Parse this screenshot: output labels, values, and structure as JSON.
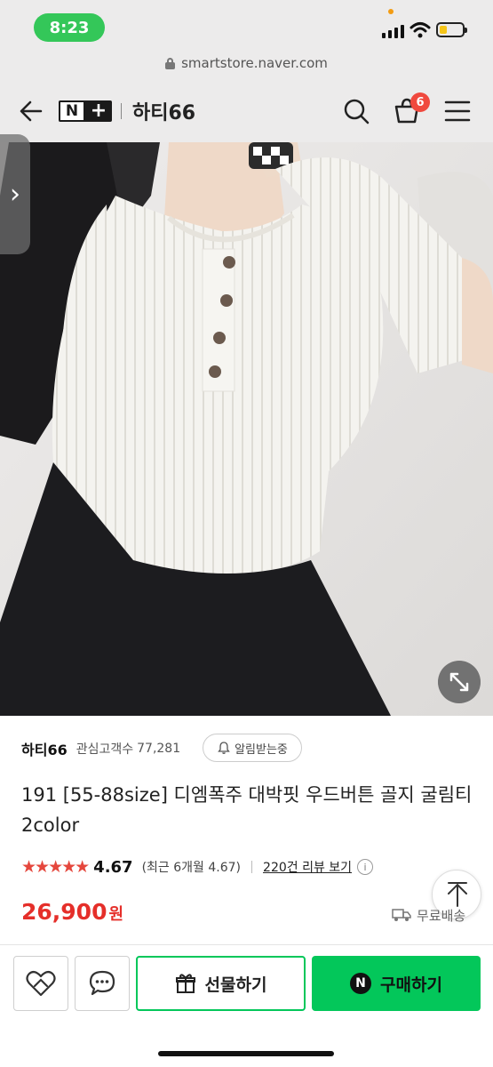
{
  "status_bar": {
    "time": "8:23",
    "battery_level": 0.35
  },
  "browser": {
    "url": "smartstore.naver.com"
  },
  "nav": {
    "logo_n": "N",
    "logo_plus": "+",
    "store_name": "하티66",
    "cart_count": "6"
  },
  "product": {
    "seller": "하티66",
    "follower_label": "관심고객수",
    "follower_count": "77,281",
    "notify_label": "알림받는중",
    "title": "191 [55-88size] 디엠폭주 대박핏 우드버튼 골지 굴림티 2color",
    "stars": "★★★★★",
    "rating": "4.67",
    "recent_rating": "(최근 6개월 4.67)",
    "review_link": "220건 리뷰 보기",
    "info_icon": "i",
    "price": "26,900",
    "currency": "원",
    "shipping": "무료배송"
  },
  "side_tab": {
    "arrow": "›"
  },
  "bottom_bar": {
    "gift_label": "선물하기",
    "buy_label": "구매하기",
    "buy_badge": "N"
  },
  "colors": {
    "naver_green": "#03c75a",
    "price_red": "#e52f2a",
    "badge_red": "#f0493e",
    "time_green": "#34c759"
  },
  "icons": [
    "lock-icon",
    "back-arrow-icon",
    "search-icon",
    "cart-icon",
    "menu-icon",
    "expand-icon",
    "bell-icon",
    "truck-icon",
    "arrow-up-icon",
    "heart-icon",
    "chat-icon",
    "gift-icon"
  ]
}
